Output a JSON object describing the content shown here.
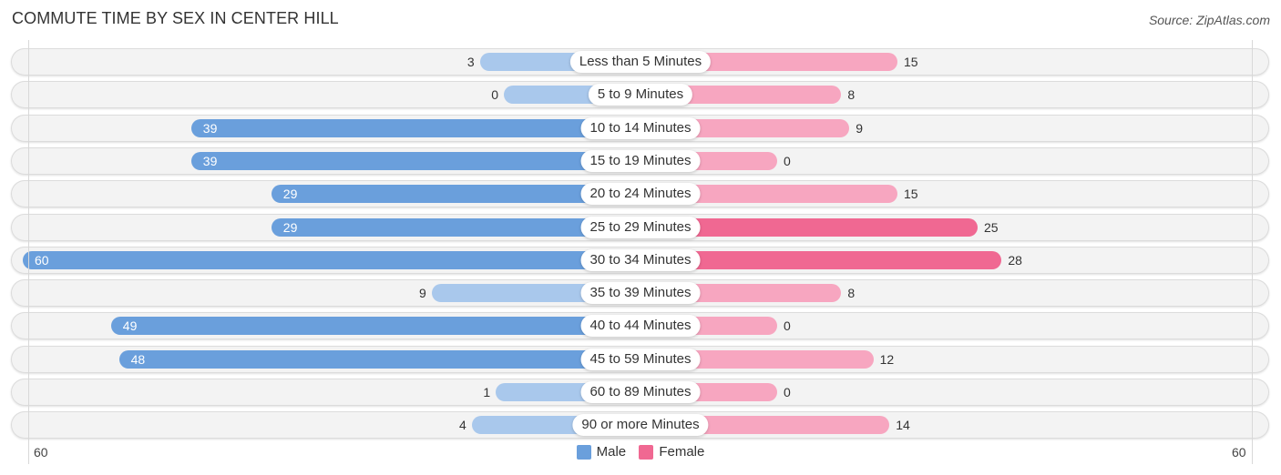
{
  "title": "COMMUTE TIME BY SEX IN CENTER HILL",
  "source": "Source: ZipAtlas.com",
  "colors": {
    "male_strong": "#6a9fdc",
    "male_light": "#a9c8ec",
    "female_strong": "#f06892",
    "female_light": "#f7a6c0"
  },
  "chart_data": {
    "type": "bar",
    "orientation": "horizontal-diverging",
    "title": "COMMUTE TIME BY SEX IN CENTER HILL",
    "categories": [
      "Less than 5 Minutes",
      "5 to 9 Minutes",
      "10 to 14 Minutes",
      "15 to 19 Minutes",
      "20 to 24 Minutes",
      "25 to 29 Minutes",
      "30 to 34 Minutes",
      "35 to 39 Minutes",
      "40 to 44 Minutes",
      "45 to 59 Minutes",
      "60 to 89 Minutes",
      "90 or more Minutes"
    ],
    "series": [
      {
        "name": "Male",
        "values": [
          3,
          0,
          39,
          39,
          29,
          29,
          60,
          9,
          49,
          48,
          1,
          4
        ]
      },
      {
        "name": "Female",
        "values": [
          15,
          8,
          9,
          0,
          15,
          25,
          28,
          8,
          0,
          12,
          0,
          14
        ]
      }
    ],
    "xlim": [
      -60,
      60
    ],
    "axis_labels": {
      "left": "60",
      "right": "60"
    },
    "legend": {
      "items": [
        "Male",
        "Female"
      ],
      "position": "bottom-center"
    }
  }
}
